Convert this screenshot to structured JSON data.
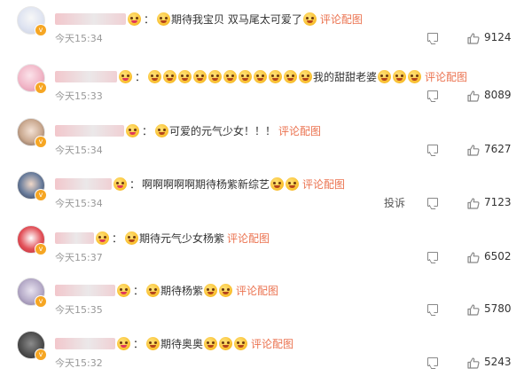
{
  "icons": {
    "reply": "comment-reply-icon",
    "like": "thumbs-up-icon",
    "verified": "orange-v-badge-icon",
    "emoji": "yellow-face-emoji"
  },
  "colors": {
    "link": "#eb7350",
    "time": "#999999",
    "text": "#333333",
    "badge": "#f6a623"
  },
  "comments": [
    {
      "username": "小仙女的宝贝",
      "pre_emojis": 1,
      "text": "期待我宝贝 双马尾太可爱了",
      "post_emojis": 1,
      "pic_link": "评论配图",
      "time": "今天15:34",
      "likes": "9124",
      "report": "",
      "avatar_bg": "radial-gradient(circle at 50% 40%, #f7f7f7 0%, #dfe4f1 55%, #c9cfe0 100%)"
    },
    {
      "username": "甜甜的小宝贝呀",
      "pre_emojis": 11,
      "text": "我的甜甜老婆",
      "post_emojis": 3,
      "pic_link": "评论配图",
      "time": "今天15:33",
      "likes": "8089",
      "report": "",
      "avatar_bg": "radial-gradient(circle at 45% 40%, #fbe3ea 0%, #f1b6c7 55%, #d98ca4 100%)"
    },
    {
      "username": "元气少女杨紫",
      "pre_emojis": 1,
      "text": "可爱的元气少女！！！",
      "post_emojis": 0,
      "pic_link": "评论配图",
      "time": "今天15:34",
      "likes": "7627",
      "report": "",
      "avatar_bg": "radial-gradient(circle at 50% 45%, #f3e1d4 0%, #c9a88f 55%, #6b5548 100%)"
    },
    {
      "username": "杨紫的粉丝",
      "pre_emojis": 0,
      "text": "啊啊啊啊啊期待杨紫新综艺",
      "post_emojis": 2,
      "pic_link": "评论配图",
      "time": "今天15:34",
      "likes": "7123",
      "report": "投诉",
      "avatar_bg": "radial-gradient(circle at 50% 45%, #f0d8c8 0%, #6a7d9c 55%, #2c3448 100%)"
    },
    {
      "username": "紫薯宝宝呀",
      "pre_emojis": 1,
      "text": "期待元气少女杨紫",
      "post_emojis": 0,
      "pic_link": "评论配图",
      "time": "今天15:37",
      "likes": "6502",
      "report": "",
      "avatar_bg": "radial-gradient(circle at 50% 45%, #ffffff 0%, #e2525a 55%, #b8222c 100%)"
    },
    {
      "username": "杨紫的小可爱",
      "pre_emojis": 1,
      "text": "期待杨紫",
      "post_emojis": 2,
      "pic_link": "评论配图",
      "time": "今天15:35",
      "likes": "5780",
      "report": "",
      "avatar_bg": "radial-gradient(circle at 50% 45%, #e7e2ef 0%, #b6abc8 55%, #7d7194 100%)"
    },
    {
      "username": "奥奥的宝贝",
      "pre_emojis": 1,
      "text": "期待奥奥",
      "post_emojis": 3,
      "pic_link": "评论配图",
      "time": "今天15:32",
      "likes": "5243",
      "report": "",
      "avatar_bg": "radial-gradient(circle at 50% 45%, #8b8b8b 0%, #4f4f4f 55%, #262626 100%)"
    }
  ]
}
